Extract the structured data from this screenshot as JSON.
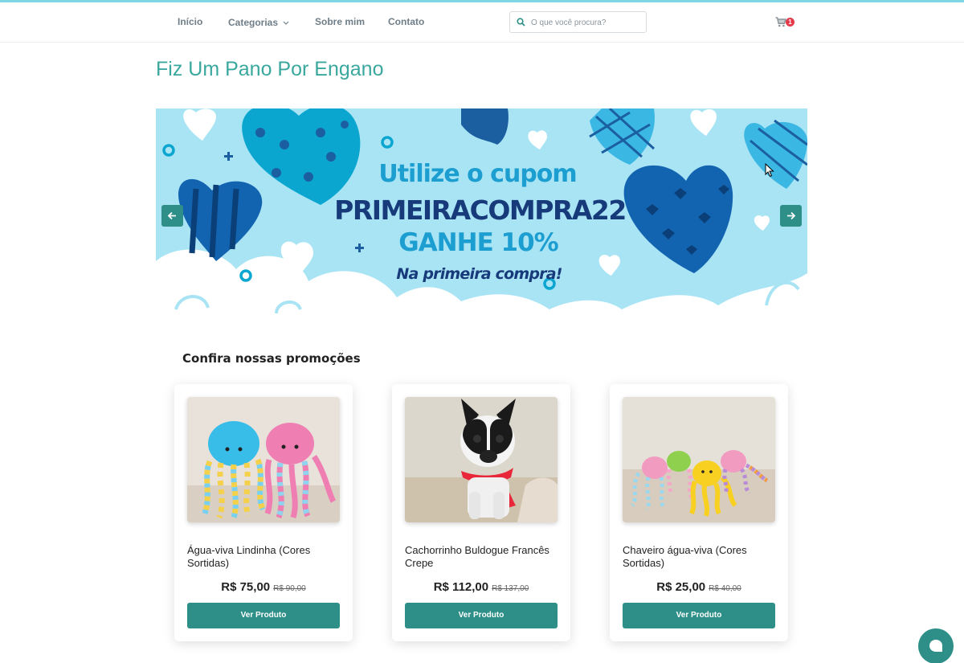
{
  "nav": {
    "items": [
      {
        "label": "Início"
      },
      {
        "label": "Categorias"
      },
      {
        "label": "Sobre mim"
      },
      {
        "label": "Contato"
      }
    ],
    "search_placeholder": "O que você procura?",
    "cart_count": "1"
  },
  "store_title": "Fiz Um Pano Por Engano",
  "banner": {
    "line1": "Utilize o cupom",
    "line2": "PRIMEIRACOMPRA22",
    "line3": "GANHE 10%",
    "line4": "Na primeira compra!"
  },
  "promotions": {
    "title": "Confira nossas promoções",
    "products": [
      {
        "name": "Água-viva Lindinha (Cores Sortidas)",
        "price": "R$ 75,00",
        "old_price": "R$ 90,00",
        "button": "Ver Produto"
      },
      {
        "name": "Cachorrinho Buldogue Francês Crepe",
        "price": "R$ 112,00",
        "old_price": "R$ 137,00",
        "button": "Ver Produto"
      },
      {
        "name": "Chaveiro água-viva (Cores Sortidas)",
        "price": "R$ 25,00",
        "old_price": "R$ 40,00",
        "button": "Ver Produto"
      }
    ]
  },
  "colors": {
    "accent": "#2e8f88",
    "title": "#3aa89e",
    "banner_bg": "#a9e4f5",
    "badge": "#e43a4b"
  },
  "icons": [
    "search-icon",
    "chevron-down-icon",
    "cart-icon",
    "arrow-left-icon",
    "arrow-right-icon",
    "chat-icon"
  ]
}
